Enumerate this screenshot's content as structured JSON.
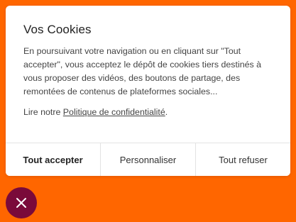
{
  "dialog": {
    "title": "Vos Cookies",
    "text": "En poursuivant votre navigation ou en cliquant sur \"Tout accepter\", vous acceptez le dépôt de cookies tiers destinés à vous proposer des vidéos, des boutons de partage, des remontées de contenus de plateformes sociales...",
    "policy_prefix": "Lire notre ",
    "policy_link": "Politique de confidentialité",
    "policy_suffix": "."
  },
  "actions": {
    "accept_all": "Tout accepter",
    "customize": "Personnaliser",
    "refuse_all": "Tout refuser"
  },
  "close_button": {
    "icon": "close-icon"
  },
  "colors": {
    "page_background": "#ff6600",
    "dialog_background": "#ffffff",
    "close_button_background": "#7a0a3a"
  }
}
